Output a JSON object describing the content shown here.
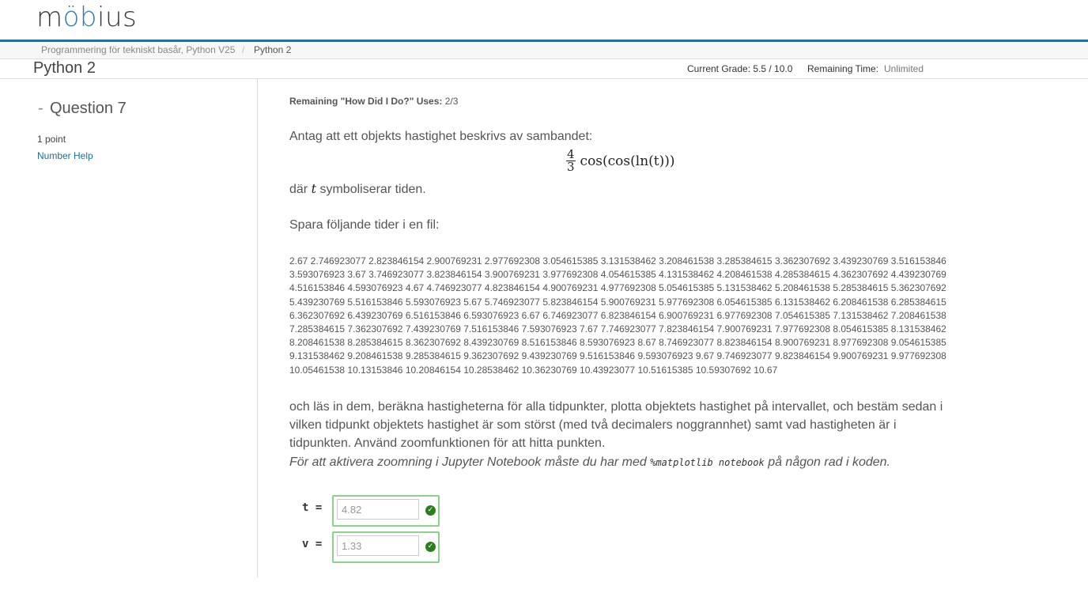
{
  "logo": {
    "pre": "m",
    "oo": "öb",
    "post": "ius"
  },
  "breadcrumb": {
    "course": "Programmering för tekniskt basår, Python V25",
    "separator": "/",
    "current": "Python 2"
  },
  "titlebar": {
    "title": "Python 2",
    "grade": "Current Grade: 5.5 / 10.0",
    "remaining_label": "Remaining Time:",
    "remaining_value": "Unlimited"
  },
  "sidebar": {
    "dash": "-",
    "question": "Question 7",
    "points": "1 point",
    "number_help": "Number Help"
  },
  "main": {
    "hdid_label": "Remaining \"How Did I Do?\" Uses:",
    "hdid_value": "2/3",
    "p1": "Antag att ett objekts hastighet beskrivs av sambandet:",
    "formula": {
      "numerator": "4",
      "denominator": "3",
      "expression": "cos(cos(ln(t)))"
    },
    "p2_pre": "där",
    "p2_var": "t",
    "p2_post": "symboliserar tiden.",
    "p3": "Spara följande tider i en fil:",
    "times": "2.67 2.746923077 2.823846154 2.900769231 2.977692308 3.054615385 3.131538462 3.208461538 3.285384615 3.362307692 3.439230769 3.516153846 3.593076923 3.67 3.746923077 3.823846154 3.900769231 3.977692308 4.054615385 4.131538462 4.208461538 4.285384615 4.362307692 4.439230769 4.516153846 4.593076923 4.67 4.746923077 4.823846154 4.900769231 4.977692308 5.054615385 5.131538462 5.208461538 5.285384615 5.362307692 5.439230769 5.516153846 5.593076923 5.67 5.746923077 5.823846154 5.900769231 5.977692308 6.054615385 6.131538462 6.208461538 6.285384615 6.362307692 6.439230769 6.516153846 6.593076923 6.67 6.746923077 6.823846154 6.900769231 6.977692308 7.054615385 7.131538462 7.208461538 7.285384615 7.362307692 7.439230769 7.516153846 7.593076923 7.67 7.746923077 7.823846154 7.900769231 7.977692308 8.054615385 8.131538462 8.208461538 8.285384615 8.362307692 8.439230769 8.516153846 8.593076923 8.67 8.746923077 8.823846154 8.900769231 8.977692308 9.054615385 9.131538462 9.208461538 9.285384615 9.362307692 9.439230769 9.516153846 9.593076923 9.67 9.746923077 9.823846154 9.900769231 9.977692308 10.05461538 10.13153846 10.20846154 10.28538462 10.36230769 10.43923077 10.51615385 10.59307692 10.67",
    "p4": "och läs in dem, beräkna hastigheterna för alla tidpunkter, plotta objektets hastighet på intervallet, och bestäm sedan i vilken tidpunkt objektets hastighet är som störst (med två decimalers noggrannhet) samt vad hastigheten är i tidpunkten. Använd zoomfunktionen för att hitta punkten.",
    "p5_pre": "För att aktivera zoomning i Jupyter Notebook måste du har med",
    "p5_code": "%matplotlib notebook",
    "p5_post": "på någon rad i koden."
  },
  "answers": [
    {
      "label": "t =",
      "value": "4.82",
      "status_icon": "check-circle-icon"
    },
    {
      "label": "v =",
      "value": "1.33",
      "status_icon": "check-circle-icon"
    }
  ],
  "colors": {
    "accent": "#2a6f94",
    "link": "#1f6f9a",
    "correct_border": "#8cd18c",
    "correct_icon": "#2e7d22"
  }
}
